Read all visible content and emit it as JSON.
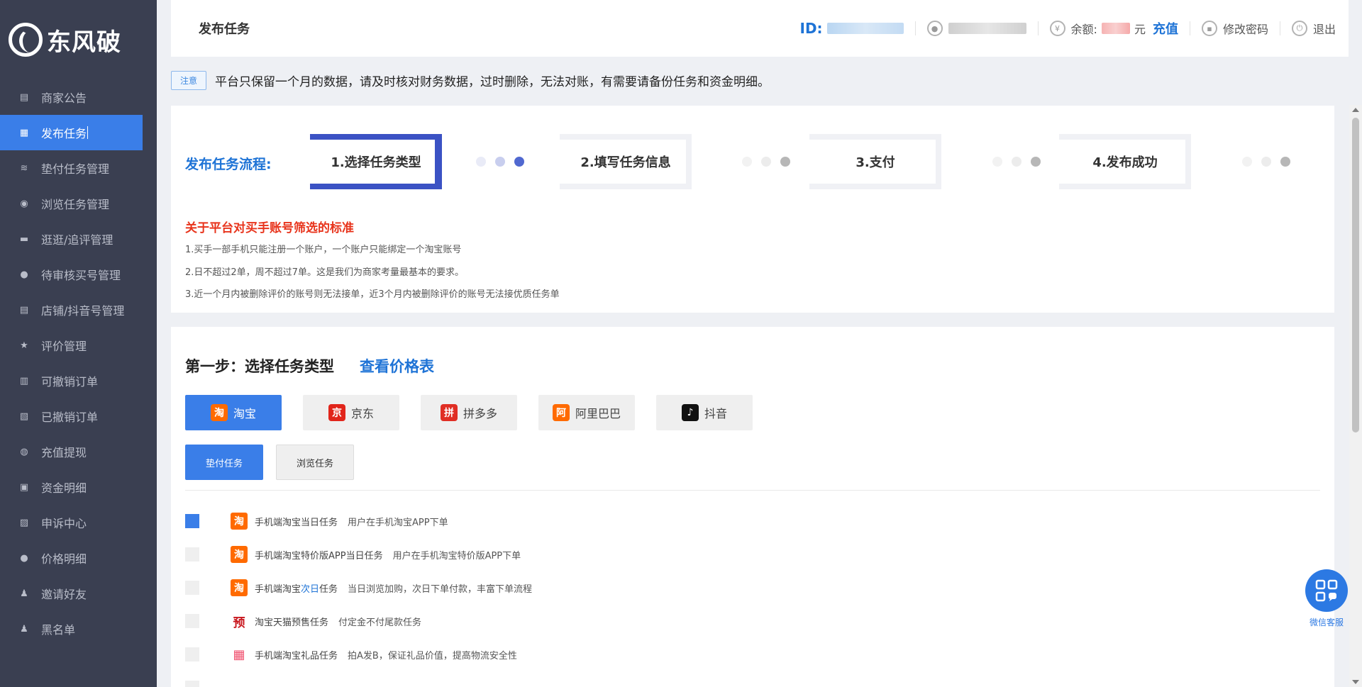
{
  "sidebar": {
    "logo_text": "东风破",
    "items": [
      {
        "label": "商家公告",
        "icon": "archive-icon"
      },
      {
        "label": "发布任务",
        "icon": "document-icon"
      },
      {
        "label": "垫付任务管理",
        "icon": "money-icon"
      },
      {
        "label": "浏览任务管理",
        "icon": "eye-icon"
      },
      {
        "label": "逛逛/追评管理",
        "icon": "chat-icon"
      },
      {
        "label": "待审核买号管理",
        "icon": "user-icon"
      },
      {
        "label": "店铺/抖音号管理",
        "icon": "store-icon"
      },
      {
        "label": "评价管理",
        "icon": "star-icon"
      },
      {
        "label": "可撤销订单",
        "icon": "file-icon"
      },
      {
        "label": "已撤销订单",
        "icon": "file-x-icon"
      },
      {
        "label": "充值提现",
        "icon": "bag-icon"
      },
      {
        "label": "资金明细",
        "icon": "wallet-icon"
      },
      {
        "label": "申诉中心",
        "icon": "complaint-icon"
      },
      {
        "label": "价格明细",
        "icon": "coin-icon"
      },
      {
        "label": "邀请好友",
        "icon": "user-plus-icon"
      },
      {
        "label": "黑名单",
        "icon": "user-block-icon"
      }
    ],
    "active_index": 1
  },
  "header": {
    "title": "发布任务",
    "id_label": "ID:",
    "balance_label": "余额:",
    "currency": "元",
    "recharge": "充值",
    "change_password": "修改密码",
    "logout": "退出"
  },
  "notice": {
    "tag": "注意",
    "text": "平台只保留一个月的数据，请及时核对财务数据，过时删除，无法对账，有需要请备份任务和资金明细。"
  },
  "flow": {
    "label": "发布任务流程:",
    "steps": [
      "1.选择任务类型",
      "2.填写任务信息",
      "3.支付",
      "4.发布成功"
    ]
  },
  "standards": {
    "title": "关于平台对买手账号筛选的标准",
    "lines": [
      "1.买手一部手机只能注册一个账户，一个账户只能绑定一个淘宝账号",
      "2.日不超过2单，周不超过7单。这是我们为商家考量最基本的要求。",
      "3.近一个月内被删除评价的账号则无法接单，近3个月内被删除评价的账号无法接优质任务单"
    ]
  },
  "step1": {
    "title": "第一步：选择任务类型",
    "price_link": "查看价格表",
    "platforms": [
      {
        "label": "淘宝",
        "icon": "taobao-icon",
        "color": "#ff6a00",
        "glyph": "淘"
      },
      {
        "label": "京东",
        "icon": "jd-icon",
        "color": "#e1251b",
        "glyph": "京"
      },
      {
        "label": "拼多多",
        "icon": "pinduoduo-icon",
        "color": "#e02e24",
        "glyph": "拼"
      },
      {
        "label": "阿里巴巴",
        "icon": "alibaba-icon",
        "color": "#ff6a00",
        "glyph": "阿"
      },
      {
        "label": "抖音",
        "icon": "douyin-icon",
        "color": "#111111",
        "glyph": "♪"
      }
    ],
    "task_types": [
      "垫付任务",
      "浏览任务"
    ],
    "options": [
      {
        "name": "手机端淘宝当日任务",
        "desc": "用户在手机淘宝APP下单",
        "icon": "taobao-icon",
        "checked": true
      },
      {
        "name": "手机端淘宝特价版APP当日任务",
        "desc": "用户在手机淘宝特价版APP下单",
        "icon": "taobao-icon",
        "checked": false
      },
      {
        "name_pre": "手机端淘宝",
        "name_hl": "次日",
        "name_post": "任务",
        "desc": "当日浏览加购，次日下单付款，丰富下单流程",
        "icon": "taobao-icon",
        "checked": false
      },
      {
        "name": "淘宝天猫预售任务",
        "desc": "付定金不付尾款任务",
        "icon": "presale-icon",
        "checked": false
      },
      {
        "name": "手机端淘宝礼品任务",
        "desc": "拍A发B，保证礼品价值，提高物流安全性",
        "icon": "gift-icon",
        "checked": false
      }
    ]
  },
  "wechat": {
    "label": "微信客服"
  },
  "colors": {
    "accent": "#3a7ee8",
    "sidebar": "#3a3f51",
    "link": "#1e73d6",
    "warning": "#e8341c"
  }
}
